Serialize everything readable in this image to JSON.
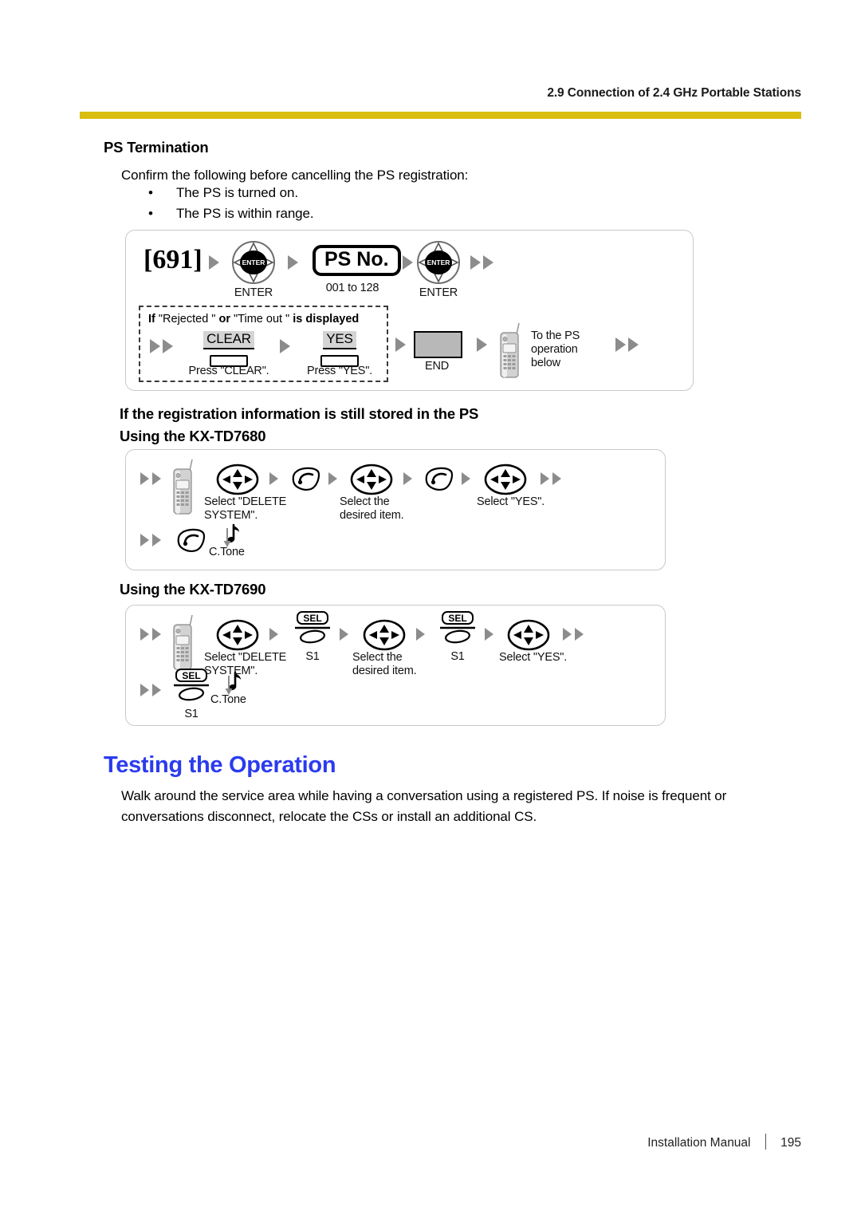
{
  "header": {
    "section_title": "2.9 Connection of 2.4 GHz Portable Stations",
    "rule_color": "#D9BD0F"
  },
  "sections": {
    "ps_termination": {
      "heading": "PS Termination",
      "intro": "Confirm the following before cancelling the PS registration:",
      "bullets": [
        {
          "marker": "•",
          "text": "The PS is turned on."
        },
        {
          "marker": "•",
          "text": "The PS is within range."
        }
      ]
    },
    "still_stored": {
      "heading": "If the registration information is still stored in the PS",
      "sub_7680": "Using the KX-TD7680",
      "sub_7690": "Using the KX-TD7690"
    },
    "testing": {
      "heading": "Testing the Operation",
      "heading_color": "#2B3BEE",
      "paragraph": "Walk around the service area while having a conversation using a registered PS. If noise is frequent or conversations disconnect, relocate the CSs or install an additional CS."
    }
  },
  "diagram_main": {
    "feature_code": "[691]",
    "enter_key_1": {
      "key_text": "ENTER",
      "caption": "ENTER"
    },
    "ps_no_box": {
      "label": "PS No.",
      "range": "001 to 128"
    },
    "enter_key_2": {
      "key_text": "ENTER",
      "caption": "ENTER"
    },
    "conditional_box": {
      "title_if": "If",
      "title_quote_1": "\"Rejected   \"",
      "title_or": "or",
      "title_quote_2": "\"Time out   \"",
      "title_tail": "is displayed",
      "clear_key": {
        "label": "CLEAR",
        "caption": "Press \"CLEAR\"."
      },
      "yes_key": {
        "label": "YES",
        "caption": "Press \"YES\"."
      }
    },
    "end_key": {
      "caption": "END"
    },
    "ps_note": "To the PS\noperation\nbelow"
  },
  "diagram_7680": {
    "steps": [
      {
        "icon": "handset-icon",
        "caption": ""
      },
      {
        "icon": "navigation-key-icon",
        "caption": "Select \"DELETE\nSYSTEM\"."
      },
      {
        "icon": "talk-key-icon",
        "caption": ""
      },
      {
        "icon": "navigation-key-icon",
        "caption": "Select the\ndesired item."
      },
      {
        "icon": "talk-key-icon",
        "caption": ""
      },
      {
        "icon": "navigation-key-icon",
        "caption": "Select \"YES\"."
      }
    ],
    "row2": [
      {
        "icon": "talk-key-icon",
        "caption": ""
      },
      {
        "icon": "confirmation-tone-icon",
        "caption": "C.Tone"
      }
    ]
  },
  "diagram_7690": {
    "steps": [
      {
        "icon": "handset-icon",
        "caption": ""
      },
      {
        "icon": "navigation-key-icon",
        "caption": "Select \"DELETE\nSYSTEM\"."
      },
      {
        "icon": "sel-key-icon",
        "label": "SEL",
        "sublabel": "S1",
        "caption": ""
      },
      {
        "icon": "navigation-key-icon",
        "caption": "Select the\ndesired item."
      },
      {
        "icon": "sel-key-icon",
        "label": "SEL",
        "sublabel": "S1",
        "caption": ""
      },
      {
        "icon": "navigation-key-icon",
        "caption": "Select \"YES\"."
      }
    ],
    "row2": [
      {
        "icon": "sel-key-icon",
        "label": "SEL",
        "sublabel": "S1",
        "caption": ""
      },
      {
        "icon": "confirmation-tone-icon",
        "caption": "C.Tone"
      }
    ]
  },
  "footer": {
    "manual_name": "Installation Manual",
    "page_number": "195"
  }
}
